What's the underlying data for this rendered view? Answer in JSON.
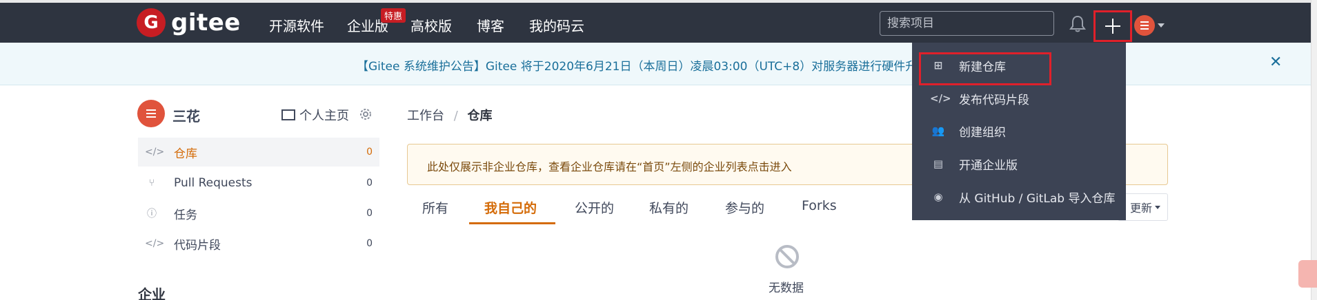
{
  "navbar": {
    "logo_text": "gitee",
    "items": [
      {
        "label": "开源软件"
      },
      {
        "label": "企业版"
      },
      {
        "label": "高校版"
      },
      {
        "label": "博客"
      },
      {
        "label": "我的码云"
      }
    ],
    "badge": "特惠",
    "search_placeholder": "搜索项目"
  },
  "notice": {
    "text": "【Gitee 系统维护公告】Gitee 将于2020年6月21日（本周日）凌晨03:00（UTC+8）对服务器进行硬件升级",
    "close": "✕"
  },
  "sidebar": {
    "user_name": "三花",
    "homepage_label": "个人主页",
    "items": [
      {
        "label": "仓库",
        "count": "0",
        "icon": "</>"
      },
      {
        "label": "Pull Requests",
        "count": "0",
        "icon": "⑂"
      },
      {
        "label": "任务",
        "count": "0",
        "icon": "ⓘ"
      },
      {
        "label": "代码片段",
        "count": "0",
        "icon": "</>"
      }
    ],
    "enterprise_title": "企业"
  },
  "main": {
    "breadcrumb": {
      "root": "工作台",
      "sep": "/",
      "current": "仓库"
    },
    "tip": "此处仅展示非企业仓库，查看企业仓库请在“首页”左侧的企业列表点击进入",
    "tabs": [
      {
        "label": "所有"
      },
      {
        "label": "我自己的"
      },
      {
        "label": "公开的"
      },
      {
        "label": "私有的"
      },
      {
        "label": "参与的"
      },
      {
        "label": "Forks"
      }
    ],
    "sort_label": "更新",
    "empty_text": "无数据"
  },
  "dropdown": {
    "items": [
      {
        "label": "新建仓库",
        "icon": "⊞"
      },
      {
        "label": "发布代码片段",
        "icon": "</>"
      },
      {
        "label": "创建组织",
        "icon": "👥"
      },
      {
        "label": "开通企业版",
        "icon": "▤"
      },
      {
        "label": "从 GitHub / GitLab 导入仓库",
        "icon": "◉"
      }
    ]
  },
  "colors": {
    "navbar_bg": "#2e3440",
    "brand_red": "#c71d23",
    "accent_orange": "#d46b08",
    "highlight_red": "#e0202a",
    "dropdown_bg": "#3c4354"
  }
}
